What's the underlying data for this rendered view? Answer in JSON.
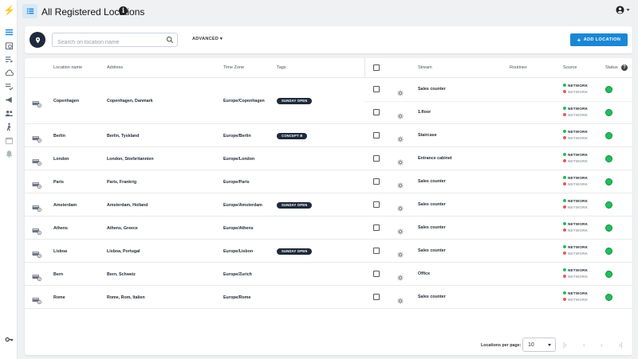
{
  "page": {
    "title": "All Registered Locations"
  },
  "toolbar": {
    "search_placeholder": "Search on location name",
    "advanced_label": "ADVANCED",
    "add_label": "ADD LOCATION"
  },
  "table": {
    "headers": {
      "location_name": "Location name",
      "address": "Address",
      "time_zone": "Time Zone",
      "tags": "Tags",
      "stream": "Stream",
      "routines": "Routines",
      "source": "Source",
      "status": "Status"
    },
    "network_label": "NETWORK",
    "rows": [
      {
        "name": "Copenhagen",
        "address": "Copenhagen, Danmark",
        "tz": "Europe/Copenhagen",
        "tag": "SUNDAY OPEN",
        "streams": [
          {
            "name": "Sales counter"
          },
          {
            "name": "1.floor"
          }
        ]
      },
      {
        "name": "Berlin",
        "address": "Berlin, Tyskland",
        "tz": "Europe/Berlin",
        "tag": "CONCEPT B",
        "streams": [
          {
            "name": "Staircase"
          }
        ]
      },
      {
        "name": "London",
        "address": "London, Storbritannien",
        "tz": "Europe/London",
        "tag": "",
        "streams": [
          {
            "name": "Entrance cabinet"
          }
        ]
      },
      {
        "name": "Paris",
        "address": "Paris, Frankrig",
        "tz": "Europe/Paris",
        "tag": "",
        "streams": [
          {
            "name": "Sales counter"
          }
        ]
      },
      {
        "name": "Amsterdam",
        "address": "Amsterdam, Holland",
        "tz": "Europe/Amsterdam",
        "tag": "SUNDAY OPEN",
        "streams": [
          {
            "name": "Sales counter"
          }
        ]
      },
      {
        "name": "Athens",
        "address": "Athens, Greece",
        "tz": "Europe/Athens",
        "tag": "",
        "streams": [
          {
            "name": "Sales counter"
          }
        ]
      },
      {
        "name": "Lisboa",
        "address": "Lisboa, Portugal",
        "tz": "Europe/Lisbon",
        "tag": "SUNDAY OPEN",
        "streams": [
          {
            "name": "Sales counter"
          }
        ]
      },
      {
        "name": "Bern",
        "address": "Bern, Schweiz",
        "tz": "Europe/Zurich",
        "tag": "",
        "streams": [
          {
            "name": "Office"
          }
        ]
      },
      {
        "name": "Rome",
        "address": "Rome, Rom, Italien",
        "tz": "Europe/Rome",
        "tag": "",
        "streams": [
          {
            "name": "Sales counter"
          }
        ]
      }
    ]
  },
  "footer": {
    "per_page_label": "Locations per page:",
    "per_page_value": "10"
  },
  "colors": {
    "accent": "#1b87d4",
    "status_ok": "#1fbf5a",
    "network_ok": "#1fbf5a",
    "network_off": "#e25b5b",
    "dark": "#1e2a3a"
  }
}
